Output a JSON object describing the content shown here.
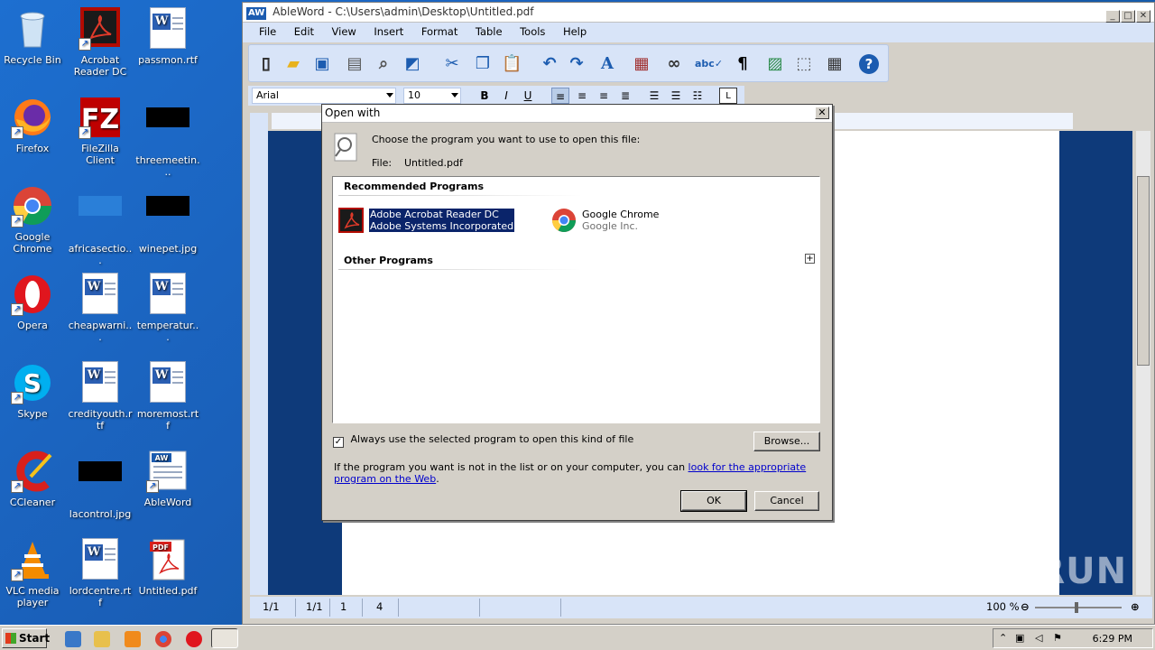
{
  "desktop": {
    "icons": [
      {
        "label": "Recycle Bin"
      },
      {
        "label": "Acrobat Reader DC"
      },
      {
        "label": "passmon.rtf"
      },
      {
        "label": "Firefox"
      },
      {
        "label": "FileZilla Client"
      },
      {
        "label": "threemeetin..."
      },
      {
        "label": "Google Chrome"
      },
      {
        "label": "africasectio..."
      },
      {
        "label": "winepet.jpg"
      },
      {
        "label": "Opera"
      },
      {
        "label": "cheapwarni..."
      },
      {
        "label": "temperatur..."
      },
      {
        "label": "Skype"
      },
      {
        "label": "credityouth.rtf"
      },
      {
        "label": "moremost.rtf"
      },
      {
        "label": "CCleaner"
      },
      {
        "label": "lacontrol.jpg"
      },
      {
        "label": "AbleWord"
      },
      {
        "label": "VLC media player"
      },
      {
        "label": "lordcentre.rtf"
      },
      {
        "label": "Untitled.pdf"
      }
    ]
  },
  "taskbar": {
    "start_label": "Start",
    "clock": "6:29 PM"
  },
  "app": {
    "logo": "AW",
    "title": "AbleWord - C:\\Users\\admin\\Desktop\\Untitled.pdf",
    "menu": [
      "File",
      "Edit",
      "View",
      "Insert",
      "Format",
      "Table",
      "Tools",
      "Help"
    ],
    "font_name": "Arial",
    "font_size": "10",
    "format_buttons": {
      "bold": "B",
      "italic": "I",
      "underline": "U"
    },
    "status": {
      "page": "1/1",
      "section": "1/1",
      "line": "1",
      "col": "4",
      "zoom": "100 %"
    }
  },
  "dialog": {
    "title": "Open with",
    "prompt": "Choose the program you want to use to open this file:",
    "file_label": "File:",
    "file_name": "Untitled.pdf",
    "recommended_header": "Recommended Programs",
    "other_header": "Other Programs",
    "programs": [
      {
        "name": "Adobe Acrobat Reader DC",
        "vendor": "Adobe Systems Incorporated",
        "selected": true
      },
      {
        "name": "Google Chrome",
        "vendor": "Google Inc.",
        "selected": false
      }
    ],
    "always_use_label": "Always use the selected program to open this kind of file",
    "always_use_checked": true,
    "browse_label": "Browse...",
    "info_text": "If the program you want is not in the list or on your computer, you can ",
    "info_link": "look for the appropriate program on the Web",
    "info_end": ".",
    "ok_label": "OK",
    "cancel_label": "Cancel"
  },
  "watermark": "ANY RUN",
  "colors": {
    "desktop_bg": "#1a5fb8",
    "selection": "#0a246a",
    "link": "#0000cc",
    "toolbar_bg": "#d8e4f8",
    "doc_bg": "#0e3a7a"
  }
}
